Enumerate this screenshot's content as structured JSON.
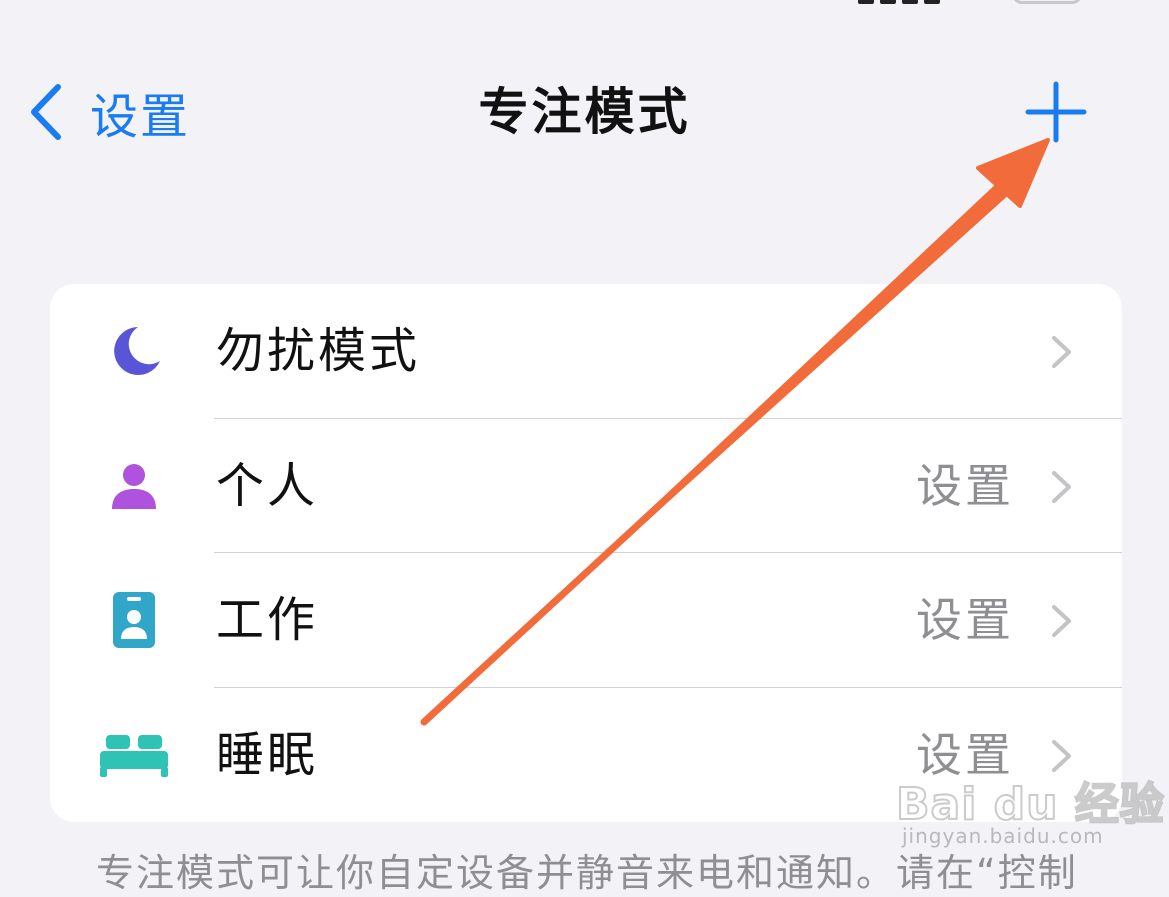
{
  "nav": {
    "back_label": "设置",
    "title": "专注模式",
    "add_icon": "plus-icon"
  },
  "focus_modes": [
    {
      "label": "勿扰模式",
      "value": "",
      "icon": "moon-icon",
      "color": "#5856d6"
    },
    {
      "label": "个人",
      "value": "设置",
      "icon": "person-icon",
      "color": "#af52de"
    },
    {
      "label": "工作",
      "value": "设置",
      "icon": "id-badge-icon",
      "color": "#30a6c8"
    },
    {
      "label": "睡眠",
      "value": "设置",
      "icon": "bed-icon",
      "color": "#2fc3b6"
    }
  ],
  "footer": {
    "note": "专注模式可让你自定设备并静音来电和通知。请在“控制"
  },
  "colors": {
    "accent": "#1a7cf2",
    "annotation_arrow": "#f26b3a",
    "background": "#f2f2f7"
  },
  "watermark": {
    "brand": "Bai du 经验",
    "site": "jingyan.baidu.com"
  }
}
